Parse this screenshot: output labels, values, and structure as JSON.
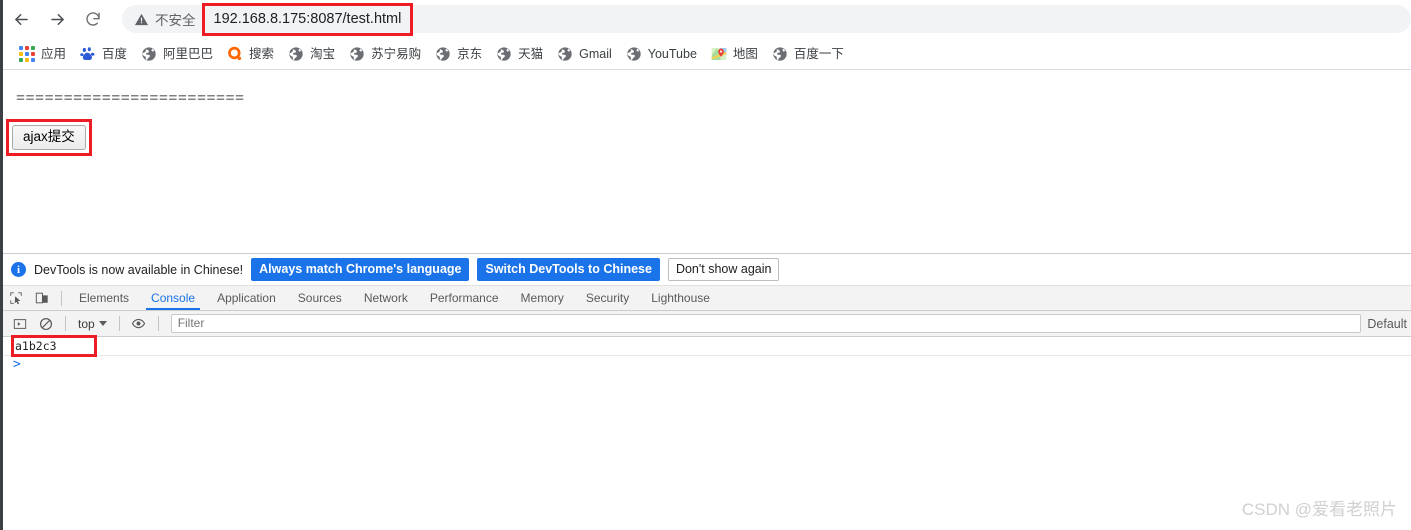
{
  "browser": {
    "nav": {
      "back_label": "Back",
      "forward_label": "Forward",
      "reload_label": "Reload"
    },
    "omnibox": {
      "security_text": "不安全",
      "security_icon": "warning-triangle-icon",
      "url": "192.168.8.175:8087/test.html",
      "highlight_color": "#ee1c25"
    },
    "bookmarks": [
      {
        "label": "应用",
        "icon": "apps-grid-icon"
      },
      {
        "label": "百度",
        "icon": "baidu-icon"
      },
      {
        "label": "阿里巴巴",
        "icon": "globe-icon"
      },
      {
        "label": "搜索",
        "icon": "search-orange-icon"
      },
      {
        "label": "淘宝",
        "icon": "globe-icon"
      },
      {
        "label": "苏宁易购",
        "icon": "globe-icon"
      },
      {
        "label": "京东",
        "icon": "globe-icon"
      },
      {
        "label": "天猫",
        "icon": "globe-icon"
      },
      {
        "label": "Gmail",
        "icon": "globe-icon"
      },
      {
        "label": "YouTube",
        "icon": "globe-icon"
      },
      {
        "label": "地图",
        "icon": "maps-pin-icon"
      },
      {
        "label": "百度一下",
        "icon": "globe-icon"
      }
    ]
  },
  "page": {
    "separator_text": "========================",
    "ajax_button_label": "ajax提交"
  },
  "devtools": {
    "notice": {
      "icon": "info-icon",
      "message": "DevTools is now available in Chinese!",
      "buttons": [
        {
          "label": "Always match Chrome's language",
          "style": "primary"
        },
        {
          "label": "Switch DevTools to Chinese",
          "style": "primary"
        },
        {
          "label": "Don't show again",
          "style": "secondary"
        }
      ],
      "primary_color": "#1a73e8"
    },
    "toolbar_icons": [
      {
        "name": "inspect-element-icon"
      },
      {
        "name": "device-toolbar-icon"
      }
    ],
    "tabs": [
      {
        "label": "Elements",
        "active": false
      },
      {
        "label": "Console",
        "active": true
      },
      {
        "label": "Application",
        "active": false
      },
      {
        "label": "Sources",
        "active": false
      },
      {
        "label": "Network",
        "active": false
      },
      {
        "label": "Performance",
        "active": false
      },
      {
        "label": "Memory",
        "active": false
      },
      {
        "label": "Security",
        "active": false
      },
      {
        "label": "Lighthouse",
        "active": false
      }
    ],
    "console_toolbar": {
      "sidebar_icon": "console-sidebar-icon",
      "clear_icon": "clear-console-icon",
      "context": "top",
      "eye_icon": "live-expression-eye-icon",
      "filter_placeholder": "Filter",
      "levels_label": "Default"
    },
    "console_messages": [
      {
        "text": "a1b2c3",
        "highlighted": true
      }
    ],
    "prompt_symbol": ">"
  },
  "watermark": {
    "text": "CSDN @爱看老照片"
  }
}
